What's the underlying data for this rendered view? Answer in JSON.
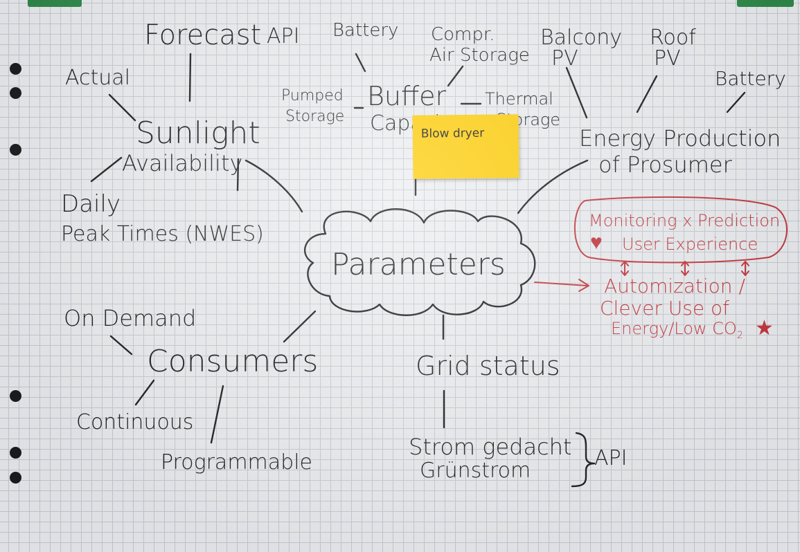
{
  "center": "Parameters",
  "forecast": {
    "label": "Forecast",
    "api": "API"
  },
  "sunlight": {
    "title_line1": "Sunlight",
    "title_line2": "Availability",
    "actual": "Actual",
    "daily_line1": "Daily",
    "daily_line2": "Peak Times (NWES)"
  },
  "buffer": {
    "title_line1": "Buffer",
    "title_line2": "Capacity",
    "battery": "Battery",
    "compressed_line1": "Compr.",
    "compressed_line2": "Air Storage",
    "pumped_line1": "Pumped",
    "pumped_line2": "Storage",
    "thermal_line1": "Thermal",
    "thermal_line2": "Storage"
  },
  "sticky_note": "Blow dryer",
  "prosumer": {
    "title_line1": "Energy Production",
    "title_line2": "of Prosumer",
    "balcony_line1": "Balcony",
    "balcony_line2": "PV",
    "roof_line1": "Roof",
    "roof_line2": "PV",
    "battery": "Battery"
  },
  "consumers": {
    "title": "Consumers",
    "on_demand": "On Demand",
    "continuous": "Continuous",
    "programmable": "Programmable"
  },
  "grid": {
    "title": "Grid status",
    "source_line1": "Strom gedacht",
    "source_line2": "Grünstrom",
    "api": "API"
  },
  "red_notes": {
    "box_line1": "Monitoring x Prediction",
    "box_line2": "User Experience",
    "heart": "♥",
    "outcome_line1": "Automization /",
    "outcome_line2": "Clever Use of",
    "outcome_line3": "Energy/Low CO",
    "outcome_subscript": "2",
    "star": "★",
    "colors": {
      "red": "#c4363c"
    }
  },
  "colors": {
    "ink": "#1c1c1e",
    "paper": "#eceef1",
    "grid": "#c9ccd3",
    "sticky": "#ffce0a"
  }
}
